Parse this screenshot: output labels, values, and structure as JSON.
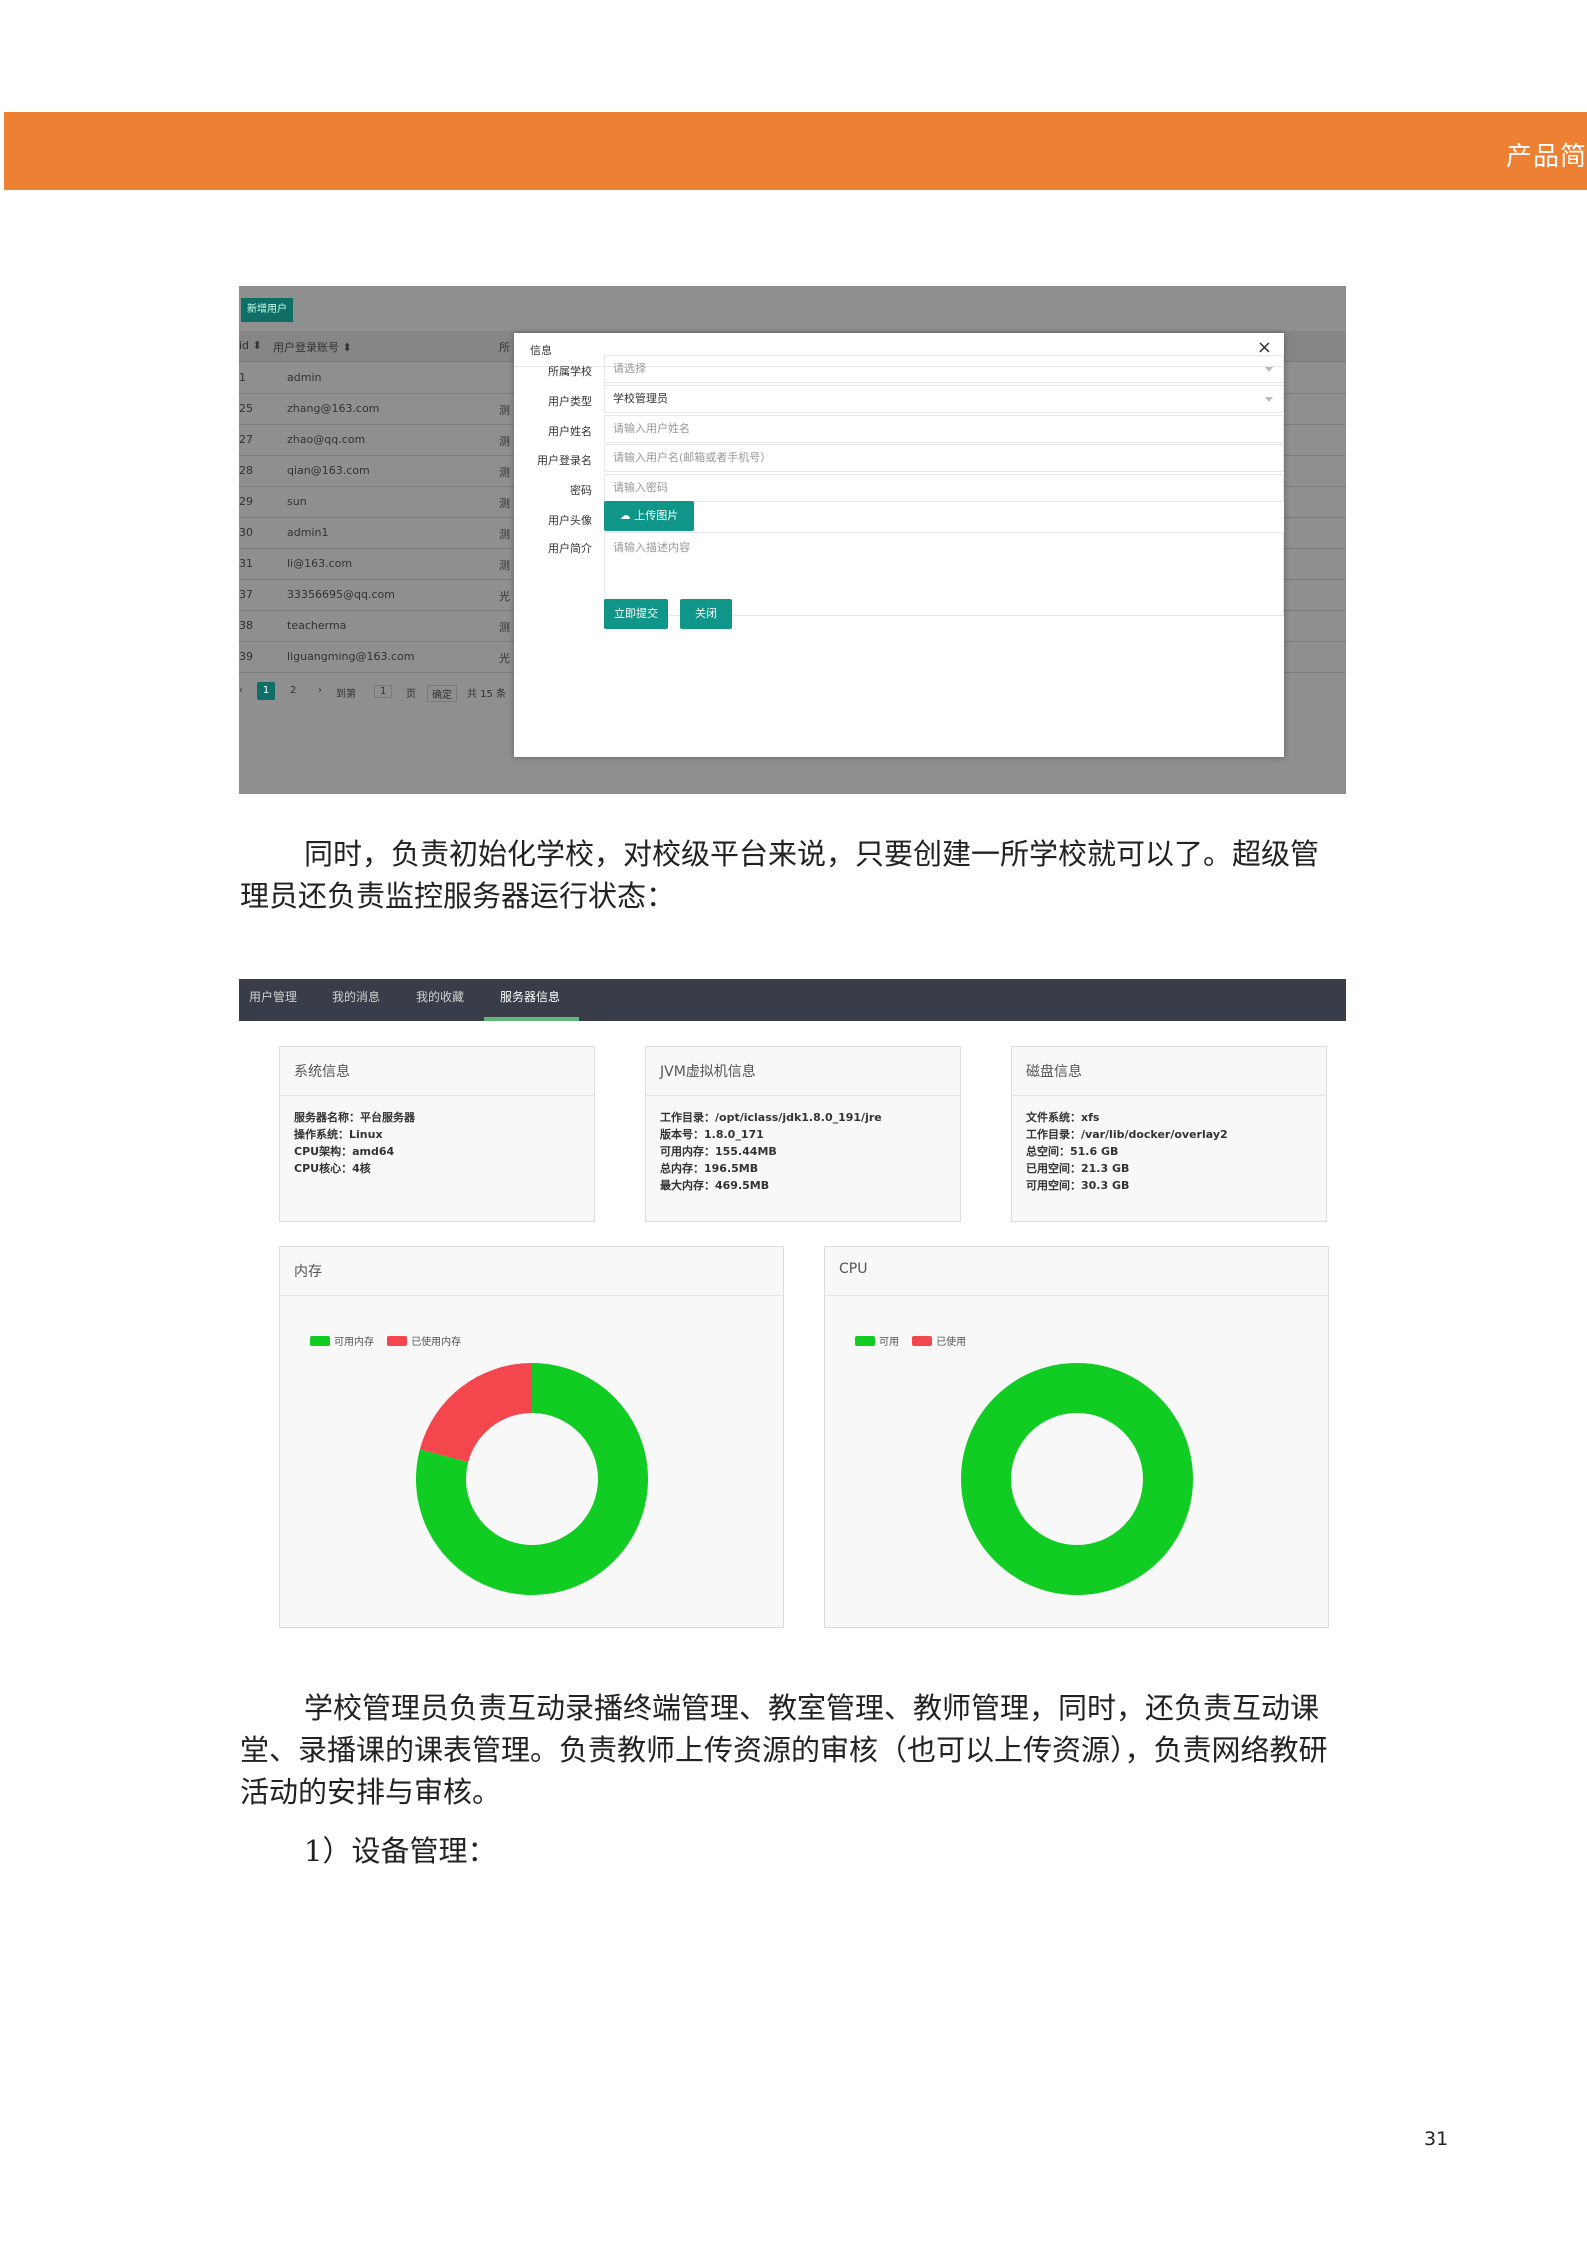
{
  "header": {
    "band_title": "产品简"
  },
  "screenshot1": {
    "new_user_button": "新增用户",
    "table_headers": [
      "id",
      "用户登录账号",
      "所"
    ],
    "rows": [
      {
        "id": "1",
        "account": "admin",
        "extra": ""
      },
      {
        "id": "25",
        "account": "zhang@163.com",
        "extra": "测"
      },
      {
        "id": "27",
        "account": "zhao@qq.com",
        "extra": "测"
      },
      {
        "id": "28",
        "account": "qian@163.com",
        "extra": "测"
      },
      {
        "id": "29",
        "account": "sun",
        "extra": "测"
      },
      {
        "id": "30",
        "account": "admin1",
        "extra": "测"
      },
      {
        "id": "31",
        "account": "li@163.com",
        "extra": "测"
      },
      {
        "id": "37",
        "account": "33356695@qq.com",
        "extra": "光"
      },
      {
        "id": "38",
        "account": "teacherma",
        "extra": "测"
      },
      {
        "id": "39",
        "account": "liguangming@163.com",
        "extra": "光"
      }
    ],
    "pager": {
      "current": "1",
      "next": "2",
      "goto": "到第",
      "page_value": "1",
      "page_unit": "页",
      "confirm": "确定",
      "total": "共 15 条"
    },
    "modal": {
      "title": "信息",
      "close": "×",
      "fields": {
        "school_label": "所属学校",
        "school_placeholder": "请选择",
        "type_label": "用户类型",
        "type_value": "学校管理员",
        "name_label": "用户姓名",
        "name_placeholder": "请输入用户姓名",
        "login_label": "用户登录名",
        "login_placeholder": "请输入用户名(邮箱或者手机号）",
        "password_label": "密码",
        "password_placeholder": "请输入密码",
        "avatar_label": "用户头像",
        "upload_button": "上传图片",
        "intro_label": "用户简介",
        "intro_placeholder": "请输入描述内容"
      },
      "submit_button": "立即提交",
      "close_button": "关闭"
    }
  },
  "paragraph1": "同时，负责初始化学校，对校级平台来说，只要创建一所学校就可以了。超级管理员还负责监控服务器运行状态：",
  "screenshot2": {
    "tabs": [
      "用户管理",
      "我的消息",
      "我的收藏",
      "服务器信息"
    ],
    "active_tab": 3,
    "system_info": {
      "title": "系统信息",
      "lines": [
        "服务器名称：平台服务器",
        "操作系统：Linux",
        "CPU架构：amd64",
        "CPU核心：4核"
      ]
    },
    "jvm_info": {
      "title": "JVM虚拟机信息",
      "lines": [
        "工作目录：/opt/iclass/jdk1.8.0_191/jre",
        "版本号：1.8.0_171",
        "可用内存：155.44MB",
        "总内存：196.5MB",
        "最大内存：469.5MB"
      ]
    },
    "disk_info": {
      "title": "磁盘信息",
      "lines": [
        "文件系统：xfs",
        "工作目录：/var/lib/docker/overlay2",
        "总空间：51.6 GB",
        "已用空间：21.3 GB",
        "可用空间：30.3 GB"
      ]
    }
  },
  "chart_data": [
    {
      "type": "pie",
      "title": "内存",
      "categories": [
        "可用内存",
        "已使用内存"
      ],
      "values": [
        155.44,
        41.06
      ],
      "colors": [
        "#11cc22",
        "#f3464d"
      ],
      "legend": "top-left"
    },
    {
      "type": "pie",
      "title": "CPU",
      "categories": [
        "可用",
        "已使用"
      ],
      "values": [
        100,
        0
      ],
      "colors": [
        "#11cc22",
        "#f3464d"
      ],
      "legend": "top-left"
    }
  ],
  "paragraph2": "学校管理员负责互动录播终端管理、教室管理、教师管理，同时，还负责互动课堂、录播课的课表管理。负责教师上传资源的审核（也可以上传资源），负责网络教研活动的安排与审核。",
  "paragraph3": "1）设备管理：",
  "page_number": "31"
}
